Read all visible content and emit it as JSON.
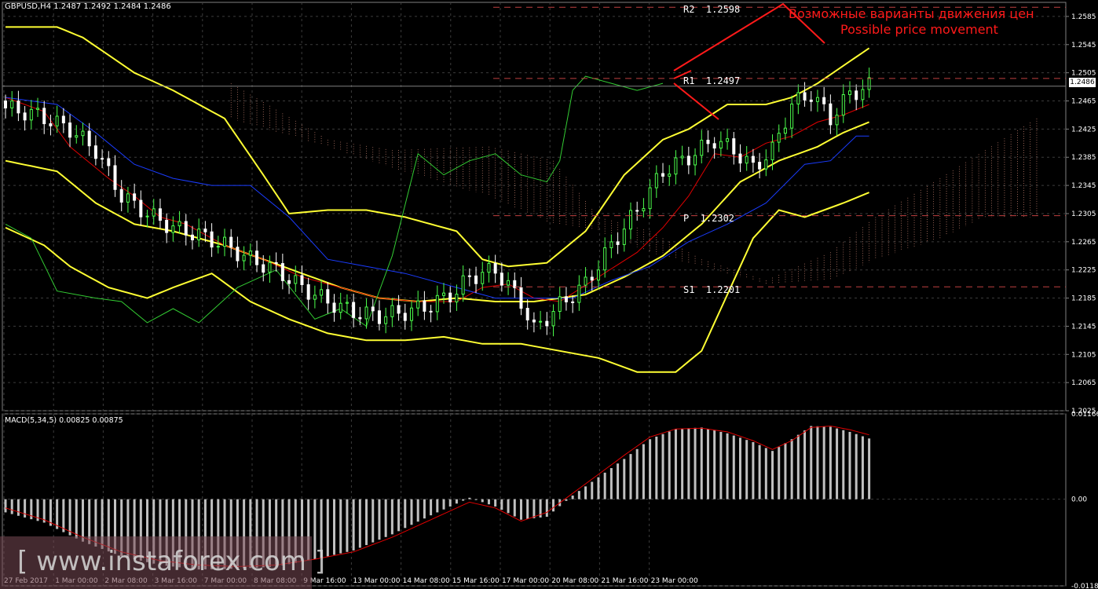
{
  "header": {
    "symbol_line": "GBPUSD,H4  1.2487 1.2492 1.2484 1.2486"
  },
  "macd": {
    "title": "MACD(5,34,5) 0.00825 0.00875"
  },
  "price_tag": "1.2486",
  "levels": [
    {
      "label": "R2  1.2598",
      "price": 1.2598
    },
    {
      "label": "R1  1.2497",
      "price": 1.2497
    },
    {
      "label": "P  1.2302",
      "price": 1.2302
    },
    {
      "label": "S1  1.2201",
      "price": 1.2201
    }
  ],
  "annotations": {
    "line1": "Возможные варианты движения цен",
    "line2": "Possible price movement"
  },
  "watermark": "[ www.instaforex.com ]",
  "colors": {
    "grid": "#3c3c3c",
    "bull": "#4cff4c",
    "bear": "#ffffff",
    "bands": "#ffff33",
    "kijun": "#e00000",
    "tenkan": "#1a3cff",
    "chikou": "#33cc33",
    "cloud": "#f4a08a",
    "arrow": "#ff1a1a",
    "hist": "#c0c0c0",
    "signal": "#e00000"
  },
  "chart_data": [
    {
      "type": "candlestick",
      "title": "GBPUSD,H4",
      "ylim": [
        1.2025,
        1.2605
      ],
      "y_ticks": [
        "1.2585",
        "1.2545",
        "1.2505",
        "1.2465",
        "1.2425",
        "1.2385",
        "1.2345",
        "1.2305",
        "1.2265",
        "1.2225",
        "1.2185",
        "1.2145",
        "1.2105",
        "1.2065",
        "1.2025"
      ],
      "x_ticks": [
        "27 Feb 2017",
        "1 Mar 00:00",
        "2 Mar 08:00",
        "3 Mar 16:00",
        "7 Mar 00:00",
        "8 Mar 08:00",
        "9 Mar 16:00",
        "13 Mar 00:00",
        "14 Mar 08:00",
        "15 Mar 16:00",
        "17 Mar 00:00",
        "20 Mar 08:00",
        "21 Mar 16:00",
        "23 Mar 00:00"
      ],
      "close_path": [
        [
          0,
          1.2455
        ],
        [
          5,
          1.2445
        ],
        [
          10,
          1.2425
        ],
        [
          14,
          1.2395
        ],
        [
          18,
          1.233
        ],
        [
          22,
          1.2305
        ],
        [
          26,
          1.2285
        ],
        [
          30,
          1.2275
        ],
        [
          34,
          1.226
        ],
        [
          38,
          1.224
        ],
        [
          42,
          1.2225
        ],
        [
          46,
          1.22
        ],
        [
          50,
          1.218
        ],
        [
          54,
          1.2165
        ],
        [
          58,
          1.216
        ],
        [
          62,
          1.2165
        ],
        [
          66,
          1.2175
        ],
        [
          70,
          1.2195
        ],
        [
          72,
          1.2215
        ],
        [
          76,
          1.2225
        ],
        [
          80,
          1.218
        ],
        [
          82,
          1.214
        ],
        [
          86,
          1.2175
        ],
        [
          90,
          1.2205
        ],
        [
          94,
          1.226
        ],
        [
          98,
          1.231
        ],
        [
          102,
          1.2365
        ],
        [
          106,
          1.2385
        ],
        [
          110,
          1.241
        ],
        [
          113,
          1.2395
        ],
        [
          116,
          1.237
        ],
        [
          119,
          1.2395
        ],
        [
          122,
          1.246
        ],
        [
          125,
          1.2475
        ],
        [
          128,
          1.244
        ],
        [
          131,
          1.2475
        ],
        [
          134,
          1.2486
        ]
      ],
      "price_tag": 1.2486
    },
    {
      "type": "bar",
      "title": "MACD(5,34,5)",
      "ylim": [
        -0.01184,
        0.01166
      ],
      "y_ticks": [
        "0.01166",
        "0.00",
        "-0.01184"
      ],
      "histogram_path": [
        [
          0,
          -0.0018
        ],
        [
          6,
          -0.0032
        ],
        [
          12,
          -0.0058
        ],
        [
          18,
          -0.0078
        ],
        [
          24,
          -0.009
        ],
        [
          30,
          -0.0096
        ],
        [
          36,
          -0.0095
        ],
        [
          42,
          -0.0092
        ],
        [
          48,
          -0.0082
        ],
        [
          54,
          -0.007
        ],
        [
          60,
          -0.0048
        ],
        [
          66,
          -0.0022
        ],
        [
          72,
          0.0002
        ],
        [
          76,
          -0.001
        ],
        [
          80,
          -0.0028
        ],
        [
          84,
          -0.0024
        ],
        [
          88,
          0.0005
        ],
        [
          92,
          0.003
        ],
        [
          96,
          0.0055
        ],
        [
          100,
          0.0082
        ],
        [
          104,
          0.0096
        ],
        [
          108,
          0.0098
        ],
        [
          112,
          0.009
        ],
        [
          116,
          0.0078
        ],
        [
          119,
          0.0066
        ],
        [
          122,
          0.0082
        ],
        [
          125,
          0.01
        ],
        [
          128,
          0.0099
        ],
        [
          131,
          0.0092
        ],
        [
          134,
          0.0083
        ]
      ],
      "signal_path": [
        [
          0,
          -0.0012
        ],
        [
          6,
          -0.0028
        ],
        [
          12,
          -0.0052
        ],
        [
          18,
          -0.0072
        ],
        [
          24,
          -0.0084
        ],
        [
          30,
          -0.009
        ],
        [
          36,
          -0.0092
        ],
        [
          42,
          -0.009
        ],
        [
          48,
          -0.0082
        ],
        [
          54,
          -0.0072
        ],
        [
          60,
          -0.0052
        ],
        [
          66,
          -0.0028
        ],
        [
          72,
          -0.0004
        ],
        [
          76,
          -0.0012
        ],
        [
          80,
          -0.003
        ],
        [
          84,
          -0.0018
        ],
        [
          88,
          0.0008
        ],
        [
          92,
          0.0034
        ],
        [
          96,
          0.006
        ],
        [
          100,
          0.0085
        ],
        [
          104,
          0.0096
        ],
        [
          108,
          0.0097
        ],
        [
          112,
          0.0092
        ],
        [
          116,
          0.008
        ],
        [
          119,
          0.0068
        ],
        [
          122,
          0.008
        ],
        [
          125,
          0.0098
        ],
        [
          128,
          0.01
        ],
        [
          131,
          0.0095
        ],
        [
          134,
          0.0088
        ]
      ],
      "macd_value": 0.00825,
      "signal_value": 0.00875
    }
  ]
}
